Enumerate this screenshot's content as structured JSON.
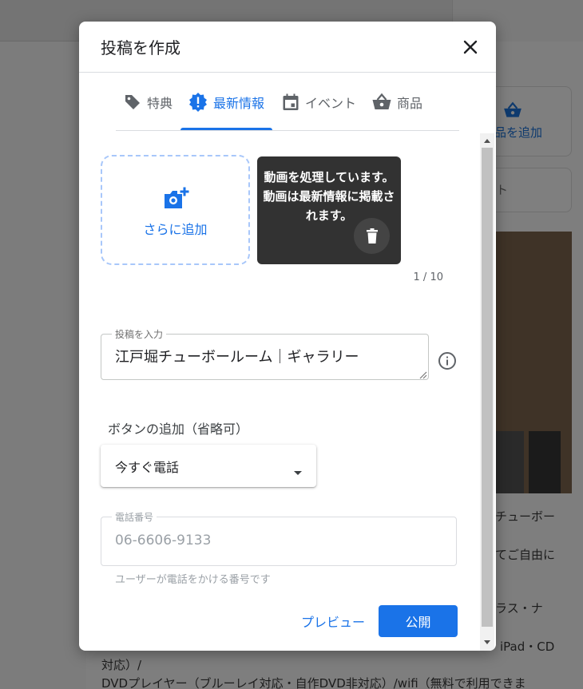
{
  "background": {
    "add_card_label": "品を追加",
    "small_card_label": "ト",
    "texts": [
      "チューボー",
      "てご自由に",
      "ラス・ナ",
      "iPad・CD",
      "対応）/",
      "DVDプレイヤー（ブルーレイ対応・自作DVD非対応）/wifi（無料で利用できま"
    ]
  },
  "modal": {
    "title": "投稿を作成",
    "tabs": [
      {
        "label": "特典",
        "icon": "tag-icon"
      },
      {
        "label": "最新情報",
        "icon": "new-badge-icon"
      },
      {
        "label": "イベント",
        "icon": "calendar-icon"
      },
      {
        "label": "商品",
        "icon": "basket-icon"
      }
    ],
    "active_tab": "最新情報",
    "media": {
      "add_more_label": "さらに追加",
      "processing_message": "動画を処理しています。動画は最新情報に掲載されます。",
      "processing_lines": [
        "動画を処理しています。",
        "動画は最新情報に掲載さ",
        "れます。"
      ],
      "counter": "1 / 10"
    },
    "post": {
      "label": "投稿を入力",
      "value": "江戸堀チューボールーム｜ギャラリー"
    },
    "button_section": {
      "heading": "ボタンの追加（省略可）",
      "selected": "今すぐ電話"
    },
    "phone": {
      "label": "電話番号",
      "value": "06-6606-9133",
      "hint": "ユーザーが電話をかける番号です"
    },
    "actions": {
      "preview": "プレビュー",
      "publish": "公開"
    }
  },
  "colors": {
    "accent": "#1a73e8",
    "dashed_border": "#a8c7fa",
    "video_tile": "#323232"
  }
}
